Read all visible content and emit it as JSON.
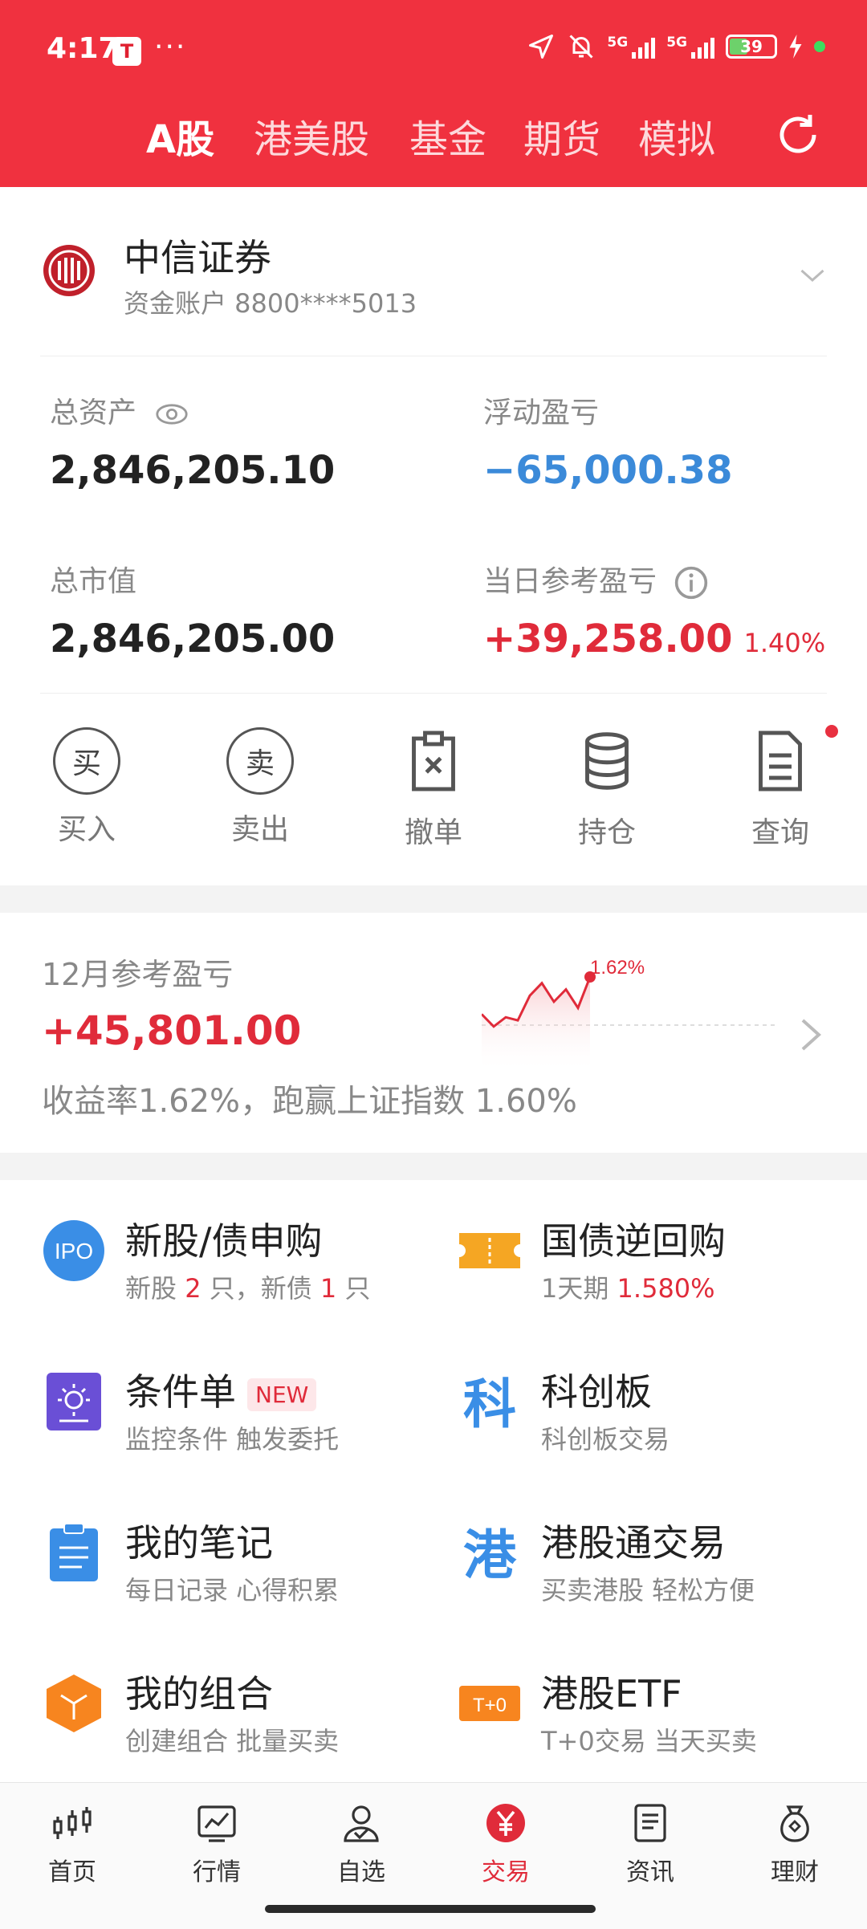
{
  "status_bar": {
    "time": "4:17",
    "dots": "···",
    "battery": "39",
    "signal_tag": "5G"
  },
  "tabs": [
    {
      "label": "A股",
      "active": true
    },
    {
      "label": "港美股",
      "active": false
    },
    {
      "label": "基金",
      "active": false
    },
    {
      "label": "期货",
      "active": false
    },
    {
      "label": "模拟",
      "active": false
    }
  ],
  "account": {
    "broker": "中信证券",
    "sub": "资金账户 8800****5013"
  },
  "metrics": {
    "total_assets_label": "总资产",
    "total_assets_value": "2,846,205.10",
    "floating_pl_label": "浮动盈亏",
    "floating_pl_value": "−65,000.38",
    "market_value_label": "总市值",
    "market_value_value": "2,846,205.00",
    "daily_pl_label": "当日参考盈亏",
    "daily_pl_value": "+39,258.00",
    "daily_pl_pct": "1.40%"
  },
  "actions": [
    {
      "label": "买入",
      "glyph": "买"
    },
    {
      "label": "卖出",
      "glyph": "卖"
    },
    {
      "label": "撤单"
    },
    {
      "label": "持仓"
    },
    {
      "label": "查询"
    }
  ],
  "monthly": {
    "title": "12月参考盈亏",
    "value": "+45,801.00",
    "summary": "收益率1.62%，跑赢上证指数 1.60%",
    "chart_label": "1.62%",
    "trend": [
      0.5,
      0.3,
      0.45,
      0.4,
      0.8,
      1.0,
      0.7,
      0.9,
      0.6,
      1.1
    ]
  },
  "features": [
    {
      "title": "新股/债申购",
      "sub_prefix": "新股 ",
      "sub_num1": "2",
      "sub_mid": " 只，新债 ",
      "sub_num2": "1",
      "sub_suffix": " 只"
    },
    {
      "title": "国债逆回购",
      "sub_prefix": "1天期 ",
      "sub_rate": "1.580%"
    },
    {
      "title": "条件单",
      "badge": "NEW",
      "sub": "监控条件 触发委托"
    },
    {
      "title": "科创板",
      "sub": "科创板交易",
      "icon_glyph": "科"
    },
    {
      "title": "我的笔记",
      "sub": "每日记录 心得积累"
    },
    {
      "title": "港股通交易",
      "sub": "买卖港股 轻松方便",
      "icon_glyph": "港"
    },
    {
      "title": "我的组合",
      "sub": "创建组合 批量买卖"
    },
    {
      "title": "港股ETF",
      "sub": "T+0交易 当天买卖",
      "icon_text": "T+0"
    }
  ],
  "ipo_icon_text": "IPO",
  "bottom_nav": [
    {
      "label": "首页",
      "active": false
    },
    {
      "label": "行情",
      "active": false
    },
    {
      "label": "自选",
      "active": false
    },
    {
      "label": "交易",
      "active": true
    },
    {
      "label": "资讯",
      "active": false
    },
    {
      "label": "理财",
      "active": false
    }
  ],
  "colors": {
    "brand_red": "#f0313f",
    "gain": "#e02b3a",
    "loss": "#3b8ad9"
  }
}
